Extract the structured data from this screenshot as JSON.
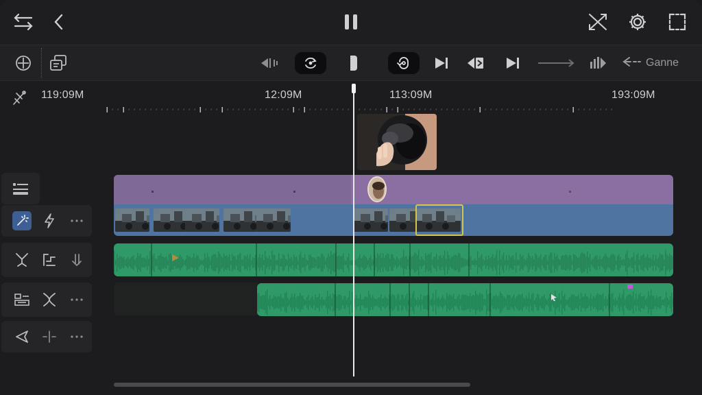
{
  "colors": {
    "background": "#1c1c1e",
    "title_track": "#8b6fa2",
    "video_track": "#4f74a2",
    "audio_track": "#2f9a67",
    "selection": "#d9c44a",
    "active_tool": "#3d5f93",
    "playhead": "#e9e9ea"
  },
  "topbar": {
    "icons": [
      "menu-arrows-icon",
      "back-chevron-icon",
      "pause-icon",
      "split-crossed-icon",
      "gear-icon",
      "fullscreen-icon"
    ]
  },
  "toolbar": {
    "icons": [
      "add-circle-icon",
      "import-media-icon",
      "rewind-mark-icon",
      "spin-effect-icon",
      "trim-bracket-icon",
      "loop-icon",
      "skip-end-icon",
      "reverse-icon",
      "next-icon",
      "arrow-line-icon",
      "speed-ramp-icon",
      "back-arrow-icon"
    ],
    "gone_label": "Ganne"
  },
  "ruler": {
    "labels": [
      "119:09M",
      "12:09M",
      "113:09M",
      "193:09M"
    ]
  },
  "side_controls": [
    {
      "name": "title-track-toggle",
      "icons": [
        "title-list-icon"
      ]
    },
    {
      "name": "video-track-controls",
      "icons": [
        "magic-wand-icon",
        "lightning-icon",
        "more-dots-icon"
      ]
    },
    {
      "name": "audio-track-1-controls",
      "icons": [
        "fork-icon",
        "volume-step-icon",
        "download-arrow-icon"
      ]
    },
    {
      "name": "audio-track-2-controls",
      "icons": [
        "layers-icon",
        "fork-icon",
        "more-dots-icon"
      ]
    },
    {
      "name": "marker-controls",
      "icons": [
        "triangle-left-icon",
        "split-line-icon",
        "more-dots-icon"
      ]
    }
  ],
  "timeline": {
    "playhead_position": 0.39,
    "scroll_position": 0.0
  }
}
